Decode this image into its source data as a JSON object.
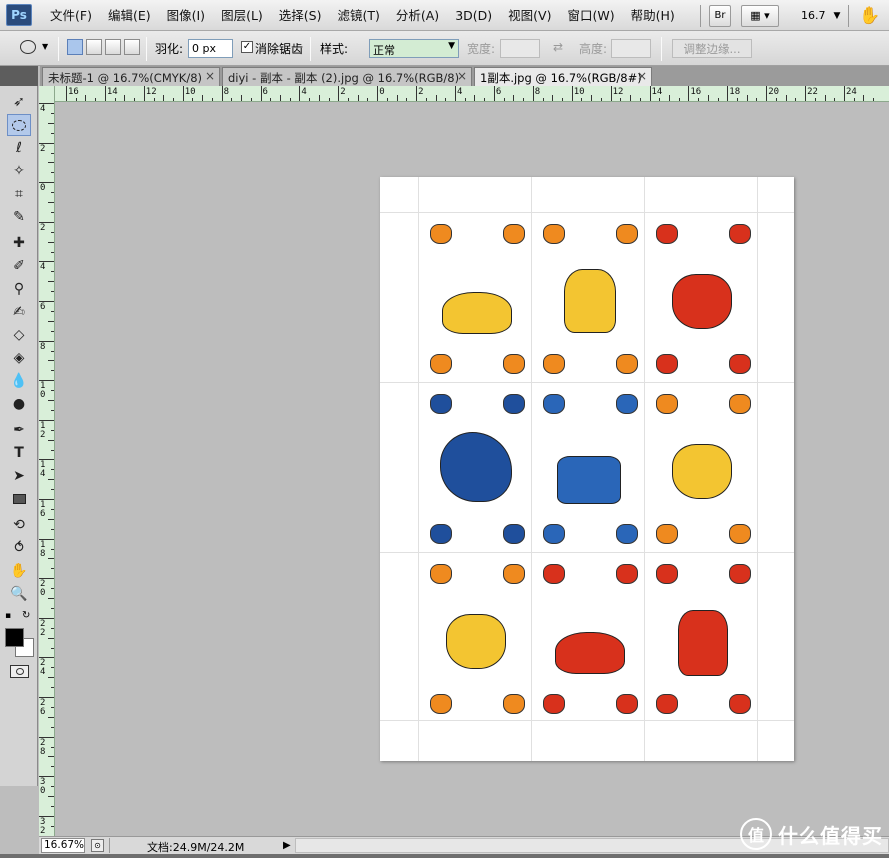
{
  "menubar": {
    "logo": "Ps",
    "items": [
      "文件(F)",
      "编辑(E)",
      "图像(I)",
      "图层(L)",
      "选择(S)",
      "滤镜(T)",
      "分析(A)",
      "3D(D)",
      "视图(V)",
      "窗口(W)",
      "帮助(H)"
    ],
    "bridge_label": "Br",
    "zoom_value": "16.7"
  },
  "options": {
    "feather_label": "羽化:",
    "feather_value": "0 px",
    "antialias_label": "消除锯齿",
    "style_label": "样式:",
    "style_value": "正常",
    "width_label": "宽度:",
    "height_label": "高度:",
    "refine_edge_label": "调整边缘..."
  },
  "tabs": [
    {
      "label": "未标题-1 @ 16.7%(CMYK/8)",
      "active": false
    },
    {
      "label": "diyi - 副本 - 副本 (2).jpg @ 16.7%(RGB/8)",
      "active": false
    },
    {
      "label": "1副本.jpg @ 16.7%(RGB/8#)",
      "active": true
    }
  ],
  "ruler_top_labels": [
    "16",
    "14",
    "12",
    "10",
    "8",
    "6",
    "4",
    "2",
    "0",
    "2",
    "4",
    "6",
    "8",
    "10",
    "12",
    "14",
    "16",
    "18",
    "20",
    "22",
    "24"
  ],
  "ruler_left_labels": [
    "4",
    "2",
    "0",
    "2",
    "4",
    "6",
    "8",
    "1 0",
    "1 2",
    "1 4",
    "1 6",
    "1 8",
    "2 0",
    "2 2",
    "2 4",
    "2 6",
    "2 8",
    "3 0",
    "3 2"
  ],
  "status": {
    "zoom": "16.67%",
    "doc_info": "文档:24.9M/24.2M"
  },
  "watermark": {
    "symbol": "值",
    "text": "什么值得买"
  },
  "colors": {
    "yellow": "#f3c531",
    "orange": "#ef8a1f",
    "red": "#d8311c",
    "blue": "#2a66b8",
    "navy": "#1f4f9c"
  }
}
